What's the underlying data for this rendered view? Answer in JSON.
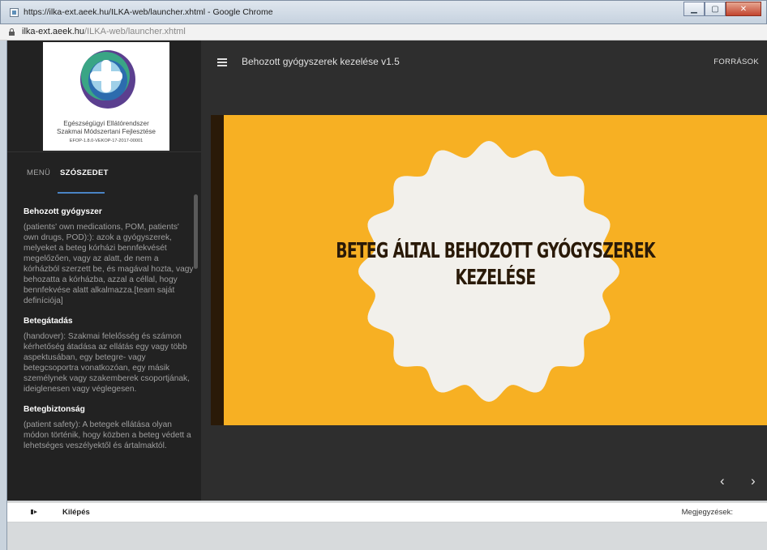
{
  "window": {
    "title": "https://ilka-ext.aeek.hu/ILKA-web/launcher.xhtml - Google Chrome",
    "controls": [
      "minimize",
      "maximize",
      "close"
    ]
  },
  "address_bar": {
    "host": "ilka-ext.aeek.hu",
    "path": "/ILKA-web/launcher.xhtml"
  },
  "sidebar": {
    "logo": {
      "line1": "Egészségügyi Ellátórendszer",
      "line2": "Szakmai Módszertani Fejlesztése",
      "line3": "EFOP-1.8.0-VEKOP-17-2017-00001"
    },
    "tabs": [
      {
        "label": "MENÜ",
        "active": false
      },
      {
        "label": "SZÓSZEDET",
        "active": true
      }
    ],
    "glossary": [
      {
        "term": "Behozott gyógyszer",
        "definition": "(patients' own medications, POM, patients' own drugs, POD):): azok a gyógyszerek, melyeket a beteg kórházi bennfekvését megelőzően, vagy az alatt, de nem a kórházból szerzett be, és magával hozta, vagy behozatta a kórházba, azzal a céllal, hogy bennfekvése alatt alkalmazza.[team saját definíciója]"
      },
      {
        "term": "Betegátadás",
        "definition": "(handover): Szakmai felelősség és számon kérhetőség átadása az ellátás egy vagy több aspektusában, egy betegre- vagy betegcsoportra vonatkozóan, egy másik személynek vagy szakemberek csoportjának, ideiglenesen vagy véglegesen."
      },
      {
        "term": "Betegbiztonság",
        "definition": "(patient safety): A betegek ellátása olyan módon történik, hogy közben a beteg védett a lehetséges veszélyektől és ártalmaktól."
      }
    ]
  },
  "header": {
    "course_title": "Behozott gyógyszerek kezelése v1.5",
    "resources_label": "FORRÁSOK"
  },
  "slide": {
    "title_line1": "BETEG ÁLTAL BEHOZOTT GYÓGYSZEREK",
    "title_line2": "KEZELÉSE",
    "colors": {
      "background": "#f7b023",
      "badge": "#f2f0eb",
      "text": "#2a1a08"
    }
  },
  "navigation": {
    "prev": "‹",
    "next": "›"
  },
  "footer": {
    "logout_label": "Kilépés",
    "notes_label": "Megjegyzések:"
  }
}
